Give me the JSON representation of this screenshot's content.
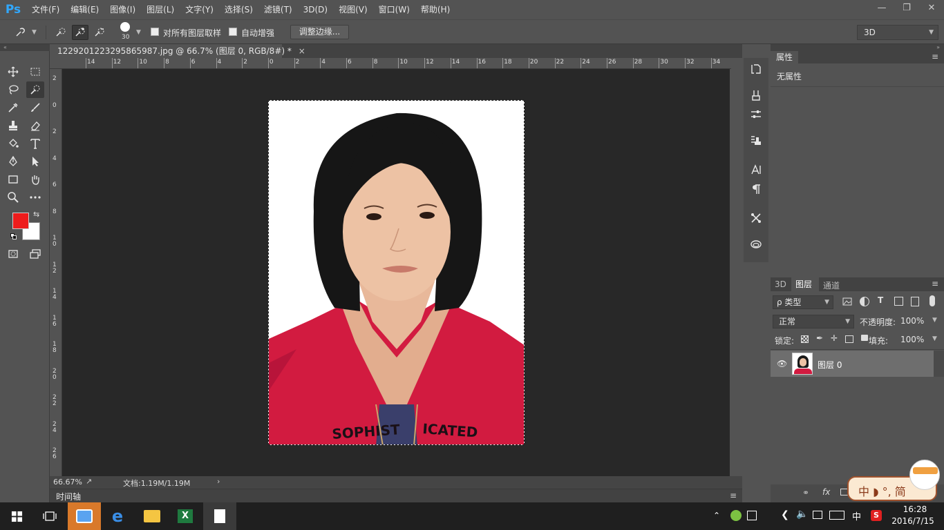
{
  "app": {
    "logo": "Ps"
  },
  "menu": [
    "文件(F)",
    "编辑(E)",
    "图像(I)",
    "图层(L)",
    "文字(Y)",
    "选择(S)",
    "滤镜(T)",
    "3D(D)",
    "视图(V)",
    "窗口(W)",
    "帮助(H)"
  ],
  "options": {
    "brush_size": "30",
    "sample_all_layers": "对所有图层取样",
    "auto_enhance": "自动增强",
    "refine_edge": "调整边缘...",
    "workspace": "3D"
  },
  "document": {
    "tab_title": "1229201223295865987.jpg @ 66.7% (图层 0, RGB/8#) *",
    "zoom": "66.67%",
    "doc_info": "文档:1.19M/1.19M"
  },
  "ruler_top_labels": [
    "14",
    "12",
    "10",
    "8",
    "6",
    "4",
    "2",
    "0",
    "2",
    "4",
    "6",
    "8",
    "10",
    "12",
    "14",
    "16",
    "18",
    "20",
    "22",
    "24",
    "26",
    "28",
    "30",
    "32",
    "34"
  ],
  "ruler_left_labels": [
    "2",
    "0",
    "2",
    "4",
    "6",
    "8",
    "1 0",
    "1 2",
    "1 4",
    "1 6",
    "1 8",
    "2 0",
    "2 2",
    "2 4",
    "2 6"
  ],
  "timeline": {
    "label": "时间轴"
  },
  "properties": {
    "title": "属性",
    "empty": "无属性"
  },
  "layers_panel": {
    "tabs": [
      "3D",
      "图层",
      "通道"
    ],
    "filter": "ρ 类型",
    "blend_mode": "正常",
    "opacity_label": "不透明度:",
    "opacity": "100%",
    "lock_label": "锁定:",
    "fill_label": "填充:",
    "fill": "100%",
    "layer_name": "图层 0"
  },
  "ime": {
    "text": "中 ◗ °, 简"
  },
  "taskbar": {
    "time": "16:28",
    "date": "2016/7/15",
    "lang": "中"
  },
  "colors": {
    "foreground": "#ee1c1c",
    "background": "#ffffff",
    "accent": "#31a8ff"
  }
}
